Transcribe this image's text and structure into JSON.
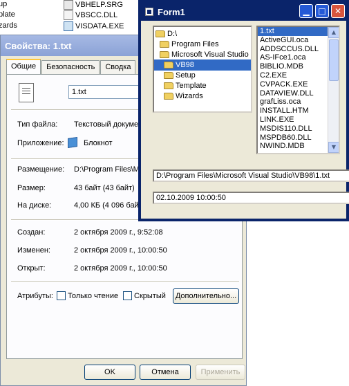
{
  "background_files": [
    {
      "label": "up",
      "icon": "file-icon"
    },
    {
      "label": "plate",
      "icon": "file-icon"
    },
    {
      "label": "zards",
      "icon": "folder-icon"
    },
    {
      "label": "VBHELP.SRG",
      "icon": "file-icon"
    },
    {
      "label": "VBSCC.DLL",
      "icon": "dll-icon"
    },
    {
      "label": "VISDATA.EXE",
      "icon": "exe-icon"
    }
  ],
  "props": {
    "title": "Свойства: 1.txt",
    "tabs": [
      "Общие",
      "Безопасность",
      "Сводка"
    ],
    "file_name": "1.txt",
    "type_label": "Тип файла:",
    "type_value": "Текстовый докуме",
    "app_label": "Приложение:",
    "app_value": "Блокнот",
    "location_label": "Размещение:",
    "location_value": "D:\\Program Files\\M",
    "size_label": "Размер:",
    "size_value": "43 байт (43 байт)",
    "disk_label": "На диске:",
    "disk_value": "4,00 КБ (4 096 бай",
    "created_label": "Создан:",
    "created_value": "2 октября 2009 г., 9:52:08",
    "modified_label": "Изменен:",
    "modified_value": "2 октября 2009 г., 10:00:50",
    "opened_label": "Открыт:",
    "opened_value": "2 октября 2009 г., 10:00:50",
    "attributes_label": "Атрибуты:",
    "readonly_label": "Только чтение",
    "hidden_label": "Скрытый",
    "advanced_button": "Дополнительно...",
    "ok_button": "OK",
    "cancel_button": "Отмена",
    "apply_button": "Применить"
  },
  "form1": {
    "title": "Form1",
    "minimize_glyph": "▁",
    "maximize_glyph": "□",
    "close_glyph": "✕",
    "dirs": [
      "D:\\",
      "Program Files",
      "Microsoft Visual Studio",
      "VB98",
      "Setup",
      "Template",
      "Wizards"
    ],
    "selected_dir": "VB98",
    "files": [
      "1.txt",
      "ActiveGUI.oca",
      "ADDSCCUS.DLL",
      "AS-IFce1.oca",
      "BIBLIO.MDB",
      "C2.EXE",
      "CVPACK.EXE",
      "DATAVIEW.DLL",
      "grafLiss.oca",
      "INSTALL.HTM",
      "LINK.EXE",
      "MSDIS110.DLL",
      "MSPDB60.DLL",
      "NWIND.MDB"
    ],
    "selected_file": "1.txt",
    "path_text": "D:\\Program Files\\Microsoft Visual Studio\\VB98\\1.txt",
    "date_text": "02.10.2009 10:00:50",
    "scroll_up": "▲",
    "scroll_down": "▼"
  }
}
